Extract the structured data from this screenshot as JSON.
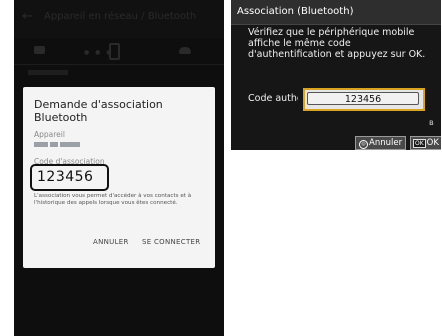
{
  "phone": {
    "app_title": "Appareil en réseau / Bluetooth",
    "dialog": {
      "title": "Demande d'association Bluetooth",
      "device_label": "Appareil",
      "code_label": "Code d'association",
      "code_value": "123456",
      "description": "L'association vous permet d'accéder à vos contacts et à l'historique des appels lorsque vous êtes connecté.",
      "cancel_label": "ANNULER",
      "connect_label": "SE CONNECTER"
    }
  },
  "camera": {
    "header": "Association (Bluetooth)",
    "message": "Vérifiez que le périphérique mobile\naffiche le même code\nd'authentification et appuyez sur OK.",
    "code_label": "Code authentification",
    "code_value": "123456",
    "bluetooth_symbol": "ʙ",
    "cancel_label": "Annuler",
    "ok_key": "OK",
    "ok_label": "OK"
  }
}
